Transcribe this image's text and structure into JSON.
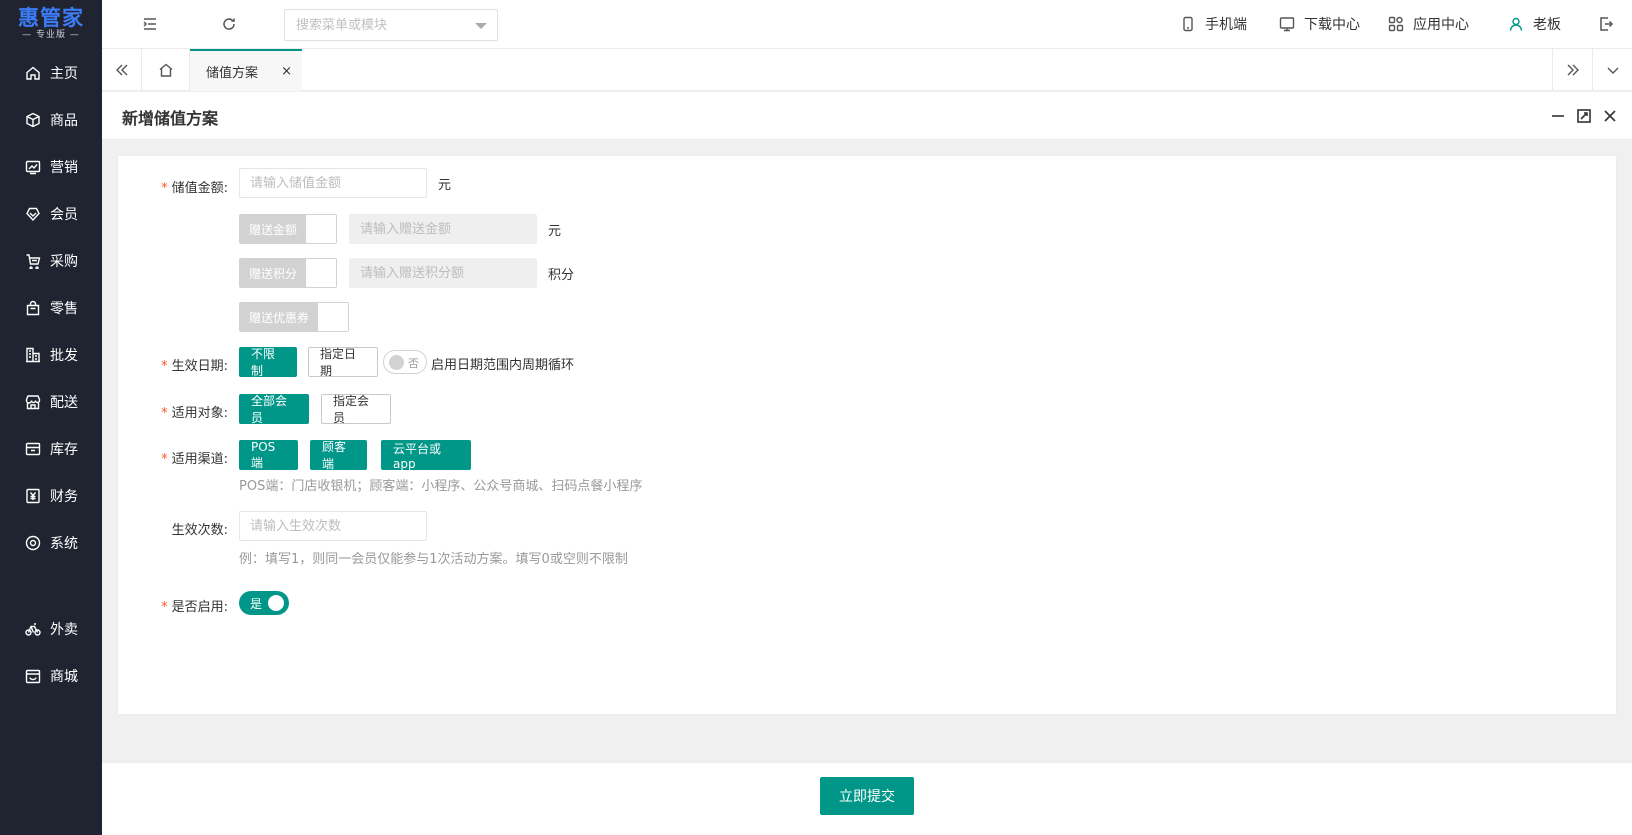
{
  "brand": {
    "name": "惠管家",
    "edition": "— 专业版 —"
  },
  "sidebar": {
    "items": [
      {
        "label": "主页",
        "icon": "home-icon"
      },
      {
        "label": "商品",
        "icon": "box-icon"
      },
      {
        "label": "营销",
        "icon": "chart-icon"
      },
      {
        "label": "会员",
        "icon": "heart-icon"
      },
      {
        "label": "采购",
        "icon": "cart-icon"
      },
      {
        "label": "零售",
        "icon": "bag-icon"
      },
      {
        "label": "批发",
        "icon": "building-icon"
      },
      {
        "label": "配送",
        "icon": "store-icon"
      },
      {
        "label": "库存",
        "icon": "inbox-icon"
      },
      {
        "label": "财务",
        "icon": "yen-icon"
      },
      {
        "label": "系统",
        "icon": "settings-icon"
      },
      {
        "label": "外卖",
        "icon": "bike-icon"
      },
      {
        "label": "商城",
        "icon": "shop-icon"
      }
    ]
  },
  "topbar": {
    "search_placeholder": "搜索菜单或模块",
    "mobile": "手机端",
    "download": "下载中心",
    "apps": "应用中心",
    "user": "老板"
  },
  "tabs": {
    "active": "储值方案",
    "close": "×"
  },
  "panel": {
    "title": "新增储值方案"
  },
  "form": {
    "amount": {
      "label": "储值金额:",
      "placeholder": "请输入储值金额",
      "unit": "元"
    },
    "gift_amount": {
      "switch": "赠送金额",
      "placeholder": "请输入赠送金额",
      "unit": "元"
    },
    "gift_points": {
      "switch": "赠送积分",
      "placeholder": "请输入赠送积分额",
      "unit": "积分"
    },
    "gift_coupon": {
      "switch": "赠送优惠券"
    },
    "date": {
      "label": "生效日期:",
      "unlimited": "不限制",
      "specify": "指定日期",
      "cycle_state": "否",
      "cycle_label": "启用日期范围内周期循环"
    },
    "target": {
      "label": "适用对象:",
      "all": "全部会员",
      "specify": "指定会员"
    },
    "channel": {
      "label": "适用渠道:",
      "pos": "POS端",
      "customer": "顾客端",
      "cloud": "云平台或app",
      "hint": "POS端：门店收银机；顾客端：小程序、公众号商城、扫码点餐小程序"
    },
    "times": {
      "label": "生效次数:",
      "placeholder": "请输入生效次数",
      "hint": "例：填写1，则同一会员仅能参与1次活动方案。填写0或空则不限制"
    },
    "enabled": {
      "label": "是否启用:",
      "state": "是"
    }
  },
  "footer": {
    "submit": "立即提交"
  },
  "colors": {
    "primary": "#009688",
    "sidebar": "#1f2430",
    "brand": "#3d7bf7",
    "required": "#ff5722"
  }
}
